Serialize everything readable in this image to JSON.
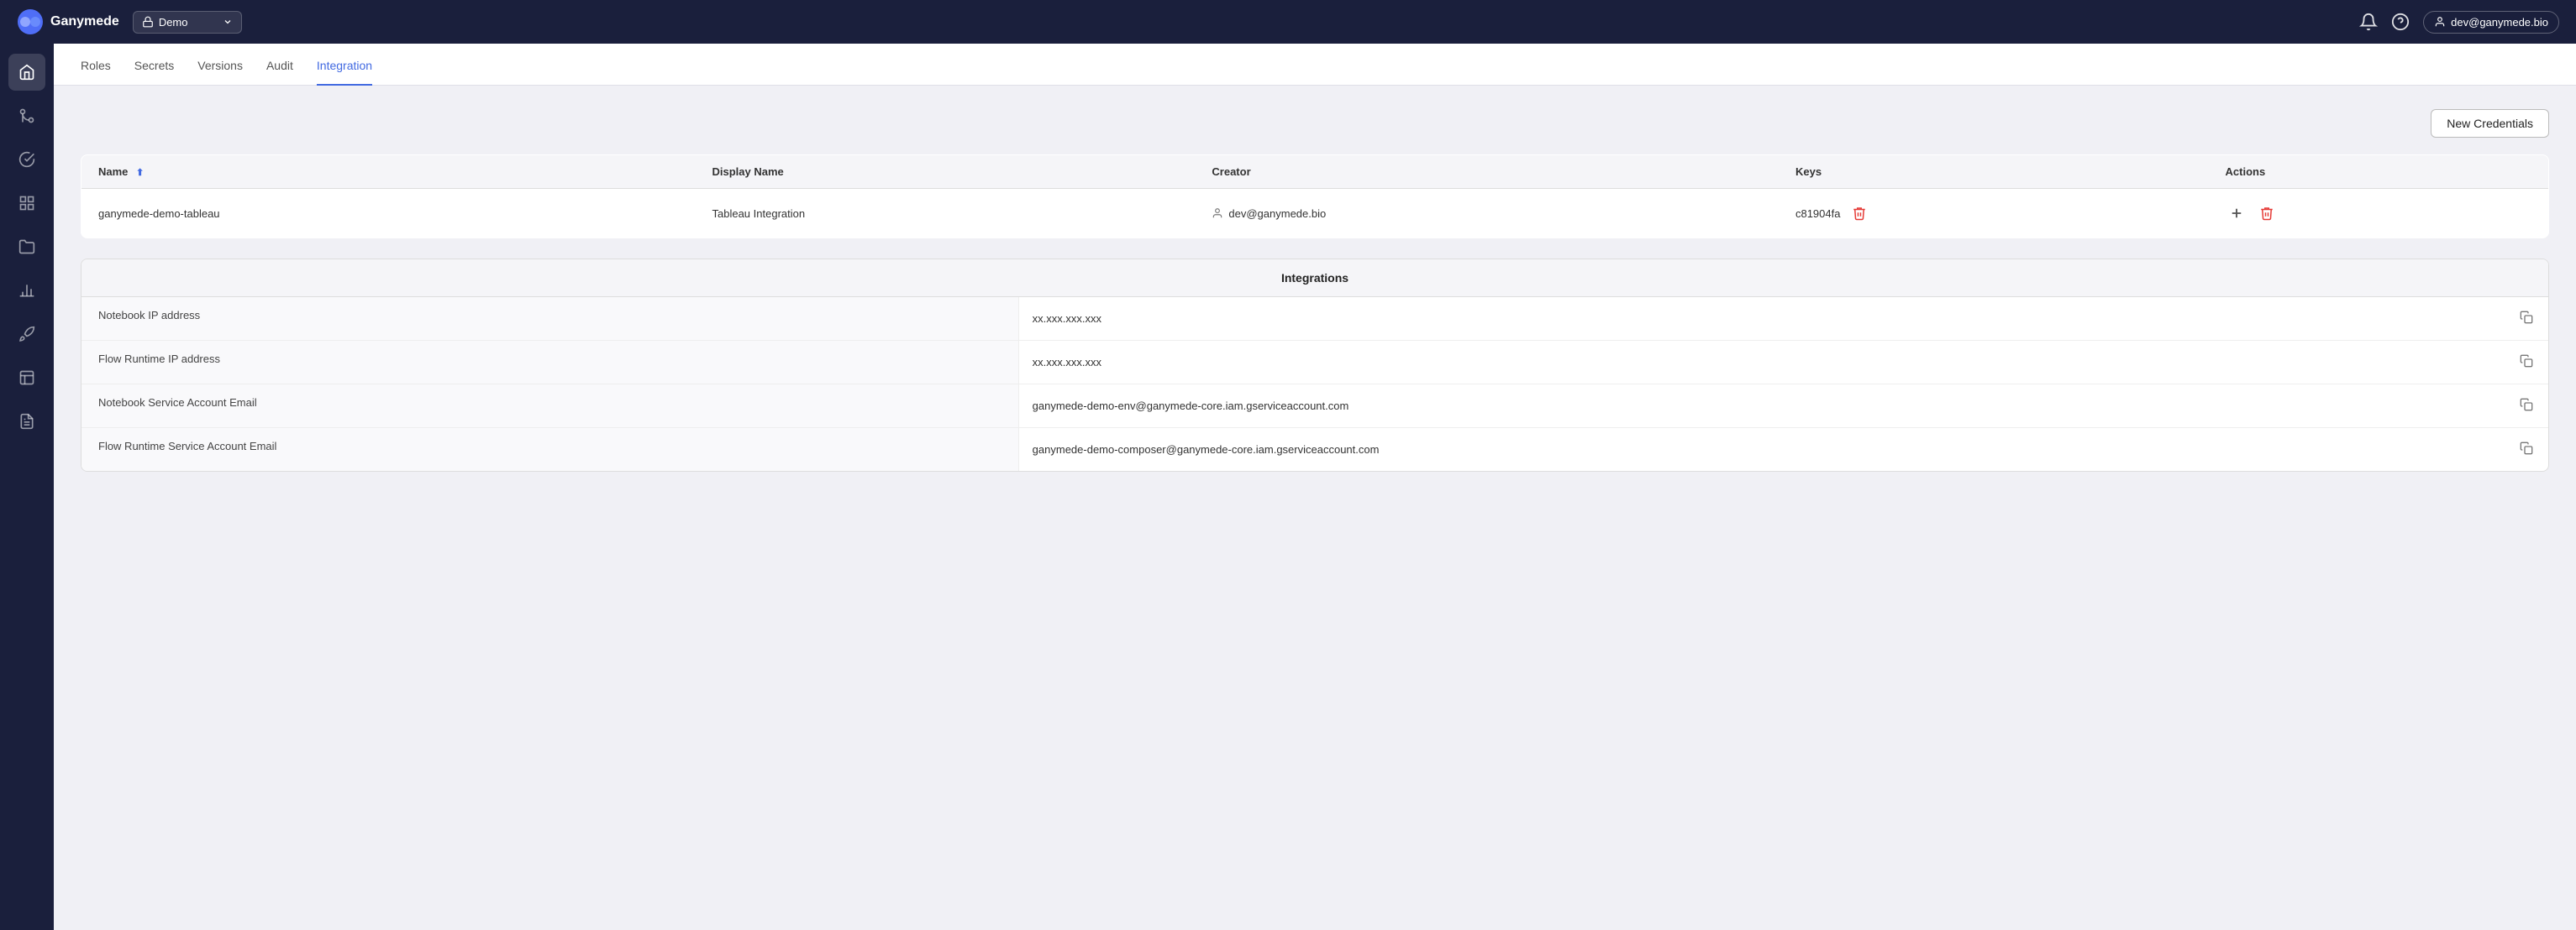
{
  "app": {
    "title": "Ganymede"
  },
  "topnav": {
    "brand_label": "Ganymede",
    "env_label": "Demo",
    "user_email": "dev@ganymede.bio"
  },
  "tabs": [
    {
      "id": "roles",
      "label": "Roles",
      "active": false
    },
    {
      "id": "secrets",
      "label": "Secrets",
      "active": false
    },
    {
      "id": "versions",
      "label": "Versions",
      "active": false
    },
    {
      "id": "audit",
      "label": "Audit",
      "active": false
    },
    {
      "id": "integration",
      "label": "Integration",
      "active": true
    }
  ],
  "new_credentials_button": "New Credentials",
  "credentials_table": {
    "columns": [
      {
        "id": "name",
        "label": "Name",
        "sortable": true
      },
      {
        "id": "display_name",
        "label": "Display Name"
      },
      {
        "id": "creator",
        "label": "Creator"
      },
      {
        "id": "keys",
        "label": "Keys"
      },
      {
        "id": "actions",
        "label": "Actions"
      }
    ],
    "rows": [
      {
        "name": "ganymede-demo-tableau",
        "display_name": "Tableau Integration",
        "creator": "dev@ganymede.bio",
        "key": "c81904fa"
      }
    ]
  },
  "integrations": {
    "header": "Integrations",
    "rows": [
      {
        "label": "Notebook IP address",
        "value": "xx.xxx.xxx.xxx"
      },
      {
        "label": "Flow Runtime IP address",
        "value": "xx.xxx.xxx.xxx"
      },
      {
        "label": "Notebook Service Account Email",
        "value": "ganymede-demo-env@ganymede-core.iam.gserviceaccount.com"
      },
      {
        "label": "Flow Runtime Service Account Email",
        "value": "ganymede-demo-composer@ganymede-core.iam.gserviceaccount.com"
      }
    ]
  },
  "sidebar": {
    "items": [
      {
        "id": "home",
        "icon": "home"
      },
      {
        "id": "git",
        "icon": "git"
      },
      {
        "id": "check",
        "icon": "check"
      },
      {
        "id": "grid",
        "icon": "grid"
      },
      {
        "id": "folder",
        "icon": "folder"
      },
      {
        "id": "chart",
        "icon": "chart"
      },
      {
        "id": "rocket",
        "icon": "rocket"
      },
      {
        "id": "dashboard",
        "icon": "dashboard"
      },
      {
        "id": "reports",
        "icon": "reports"
      }
    ]
  }
}
